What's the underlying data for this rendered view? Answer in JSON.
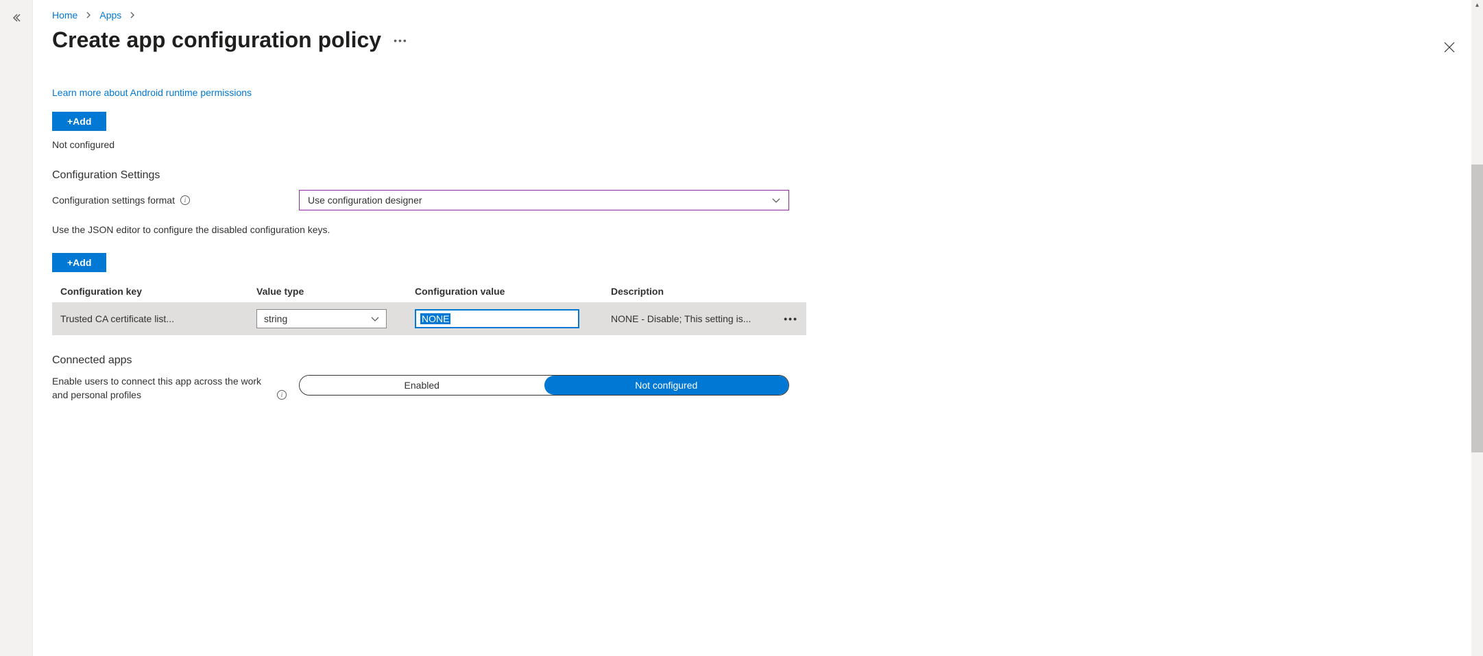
{
  "breadcrumb": {
    "home": "Home",
    "apps": "Apps"
  },
  "page": {
    "title": "Create app configuration policy"
  },
  "permissions": {
    "learn_more_link": "Learn more about Android runtime permissions",
    "add_button": "+Add",
    "status": "Not configured"
  },
  "config_settings": {
    "heading": "Configuration Settings",
    "format_label": "Configuration settings format",
    "format_value": "Use configuration designer",
    "helper": "Use the JSON editor to configure the disabled configuration keys.",
    "add_button": "+Add",
    "columns": {
      "key": "Configuration key",
      "value_type": "Value type",
      "config_value": "Configuration value",
      "description": "Description"
    },
    "rows": [
      {
        "key": "Trusted CA certificate list...",
        "value_type": "string",
        "config_value": "NONE",
        "description": "NONE - Disable; This setting is..."
      }
    ]
  },
  "connected_apps": {
    "heading": "Connected apps",
    "label": "Enable users to connect this app across the work and personal profiles",
    "option_enabled": "Enabled",
    "option_not_configured": "Not configured"
  }
}
